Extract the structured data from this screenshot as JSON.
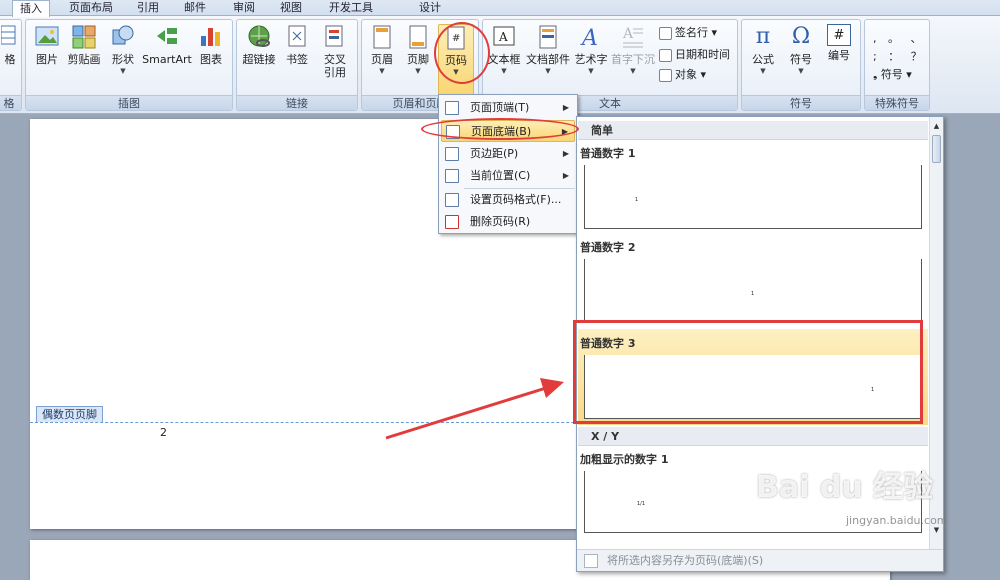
{
  "tabs": [
    "插入",
    "页面布局",
    "引用",
    "邮件",
    "审阅",
    "视图",
    "开发工具",
    "设计"
  ],
  "active_tab": "插入",
  "groups": {
    "table_partial": {
      "label": "格",
      "btn": "格"
    },
    "illustrations": {
      "label": "插图",
      "buttons": [
        "图片",
        "剪贴画",
        "形状",
        "SmartArt",
        "图表"
      ]
    },
    "links": {
      "label": "链接",
      "buttons": [
        "超链接",
        "书签",
        "交叉",
        "引用"
      ]
    },
    "header_footer": {
      "label": "页眉和页脚",
      "buttons": [
        "页眉",
        "页脚",
        "页码"
      ]
    },
    "text": {
      "label": "文本",
      "buttons": [
        "文本框",
        "文档部件",
        "艺术字",
        "首字下沉"
      ],
      "small": [
        "签名行",
        "日期和时间",
        "对象"
      ]
    },
    "symbols": {
      "label": "符号",
      "buttons": [
        "公式",
        "符号",
        "编号"
      ],
      "icons": [
        "π",
        "Ω",
        "#"
      ]
    },
    "special": {
      "label": "特殊符号",
      "rows": [
        ", 。 、",
        "; ： ？"
      ],
      "btn": "符号"
    }
  },
  "document": {
    "footer_tag": "偶数页页脚",
    "page_number": "2"
  },
  "menu": {
    "items": [
      "页面顶端(T)",
      "页面底端(B)",
      "页边距(P)",
      "当前位置(C)",
      "设置页码格式(F)...",
      "删除页码(R)"
    ]
  },
  "gallery": {
    "section_simple": "简单",
    "items": [
      "普通数字 1",
      "普通数字 2",
      "普通数字 3"
    ],
    "section_xy": "X / Y",
    "item_bold": "加粗显示的数字 1",
    "thumb_nums": [
      "1",
      "1",
      "1",
      "1/1"
    ],
    "bottom_action": "将所选内容另存为页码(底端)(S)"
  },
  "watermark": {
    "logo": "Bai du 经验",
    "url": "jingyan.baidu.com"
  },
  "colors": {
    "accent": "#e23b3b",
    "highlight": "#fbd986",
    "ribbon": "#dde6f2"
  }
}
